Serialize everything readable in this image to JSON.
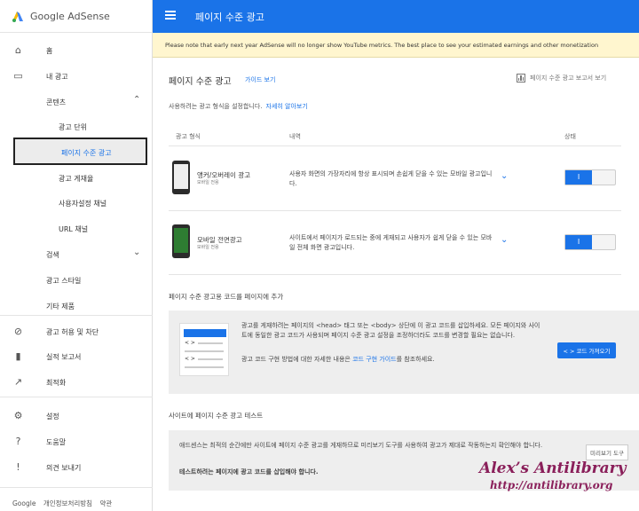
{
  "app": {
    "logo_text": "Google AdSense",
    "accent": "#1a73e8"
  },
  "sidebar": {
    "items": [
      {
        "label": "홈",
        "icon": "home-icon"
      },
      {
        "label": "내 광고",
        "icon": "ad-units-icon"
      },
      {
        "label": "콘텐츠",
        "icon": "",
        "chevron": "chevron-up-icon"
      },
      {
        "label": "광고 단위"
      },
      {
        "label": "페이지 수준 광고"
      },
      {
        "label": "광고 게재율"
      },
      {
        "label": "사용자설정 채널"
      },
      {
        "label": "URL 채널"
      },
      {
        "label": "검색",
        "chevron": "chevron-down-icon"
      },
      {
        "label": "광고 스타일"
      },
      {
        "label": "기타 제품"
      },
      {
        "label": "광고 허용 및 차단",
        "icon": "block-icon"
      },
      {
        "label": "실적 보고서",
        "icon": "bar-chart-icon"
      },
      {
        "label": "최적화",
        "icon": "trending-icon"
      },
      {
        "label": "설정",
        "icon": "gear-icon"
      },
      {
        "label": "도움말",
        "icon": "help-icon"
      },
      {
        "label": "의견 보내기",
        "icon": "feedback-icon"
      }
    ],
    "footer": {
      "google": "Google",
      "privacy": "개인정보처리방침",
      "terms": "약관"
    }
  },
  "topbar": {
    "title": "페이지 수준 광고"
  },
  "notice": {
    "text": "Please note that early next year AdSense will no longer show YouTube metrics. The best place to see your estimated earnings and other monetization"
  },
  "main": {
    "title": "페이지 수준 광고",
    "guide_link": "가이드 보기",
    "report_link": "페이지 수준 광고 보고서 보기",
    "subtitle": "사용하려는 광고 형식을 설정합니다.",
    "subtitle_link": "자세히 알아보기",
    "columns": {
      "format": "광고 형식",
      "detail": "내역",
      "status": "상태"
    },
    "rows": [
      {
        "title": "앵커/오버레이 광고",
        "small": "모바일 전용",
        "desc": "사용자 화면의 가장자리에 항상 표시되며 손쉽게 닫을 수 있는 모바일 광고입니다.",
        "toggle": "I"
      },
      {
        "title": "모바일 전면광고",
        "small": "모바일 전용",
        "desc": "사이트에서 페이지가 로드되는 중에 게재되고 사용자가 쉽게 닫을 수 있는 모바일 전체 화면 광고입니다.",
        "toggle": "I"
      }
    ],
    "code_section": {
      "heading": "페이지 수준 광고용 코드를 페이지에 추가",
      "text1": "광고를 게재하려는 페이지의 <head> 태그 또는 <body> 상단에 이 광고 코드를 삽입하세요. 모든 페이지와 사이트에 동일한 광고 코드가 사용되며 페이지 수준 광고 설정을 조정하더라도 코드를 변경할 필요는 없습니다.",
      "text2_a": "광고 코드 구현 방법에 대한 자세한 내용은 ",
      "text2_link": "코드 구현 가이드",
      "text2_b": "를 참조하세요.",
      "button": "< > 코드 가져오기",
      "code_glyph": "< >"
    },
    "test_section": {
      "heading": "사이트에 페이지 수준 광고 테스트",
      "text1": "애드센스는 최적의 순간에만 사이트에 페이지 수준 광고를 게재하므로 미리보기 도구를 사용하여 광고가 제대로 작동하는지 확인해야 합니다.",
      "text2": "테스트하려는 페이지에 광고 코드를 삽입해야 합니다.",
      "button": "미리보기 도구"
    }
  },
  "watermark": {
    "line1": "Alex’s Antilibrary",
    "line2": "http://antilibrary.org"
  }
}
